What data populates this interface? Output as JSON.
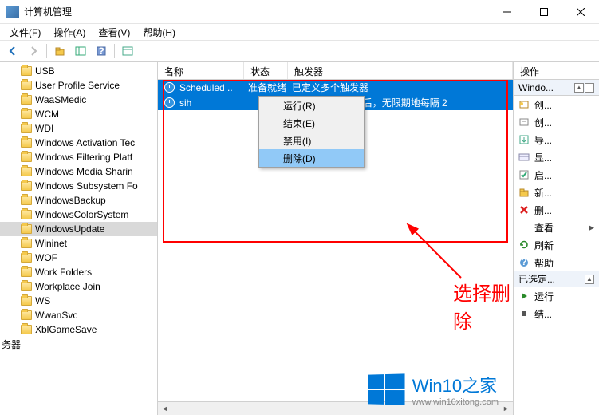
{
  "window": {
    "title": "计算机管理"
  },
  "menu": {
    "file": "文件(F)",
    "action": "操作(A)",
    "view": "查看(V)",
    "help": "帮助(H)"
  },
  "tree": {
    "items": [
      {
        "label": "USB"
      },
      {
        "label": "User Profile Service"
      },
      {
        "label": "WaaSMedic"
      },
      {
        "label": "WCM"
      },
      {
        "label": "WDI"
      },
      {
        "label": "Windows Activation Tec"
      },
      {
        "label": "Windows Filtering Platf"
      },
      {
        "label": "Windows Media Sharin"
      },
      {
        "label": "Windows Subsystem Fo"
      },
      {
        "label": "WindowsBackup"
      },
      {
        "label": "WindowsColorSystem"
      },
      {
        "label": "WindowsUpdate",
        "selected": true
      },
      {
        "label": "Wininet"
      },
      {
        "label": "WOF"
      },
      {
        "label": "Work Folders"
      },
      {
        "label": "Workplace Join"
      },
      {
        "label": "WS"
      },
      {
        "label": "WwanSvc"
      },
      {
        "label": "XblGameSave"
      }
    ],
    "footer": "务器"
  },
  "list": {
    "headers": {
      "name": "名称",
      "status": "状态",
      "trigger": "触发器"
    },
    "rows": [
      {
        "name": "Scheduled ..",
        "status": "准备就绪",
        "trigger": "已定义多个触发器"
      },
      {
        "name": "sih",
        "status": "",
        "trigger": "的 8:00 时 - 触发后，无限期地每隔 2"
      }
    ]
  },
  "context_menu": {
    "items": [
      {
        "label": "运行(R)"
      },
      {
        "label": "结束(E)"
      },
      {
        "label": "禁用(I)"
      },
      {
        "label": "删除(D)",
        "hover": true
      }
    ]
  },
  "annotation": "选择删除",
  "actions": {
    "header": "操作",
    "group1": {
      "title": "Windo..."
    },
    "items1": [
      {
        "icon": "create-basic",
        "label": "创..."
      },
      {
        "icon": "create",
        "label": "创..."
      },
      {
        "icon": "import",
        "label": "导..."
      },
      {
        "icon": "display",
        "label": "显..."
      },
      {
        "icon": "enable",
        "label": "启..."
      },
      {
        "icon": "new-folder",
        "label": "新..."
      },
      {
        "icon": "delete",
        "label": "删..."
      },
      {
        "icon": "view",
        "label": "查看",
        "submenu": true
      },
      {
        "icon": "refresh",
        "label": "刷新"
      },
      {
        "icon": "help",
        "label": "帮助"
      }
    ],
    "group2": {
      "title": "已选定..."
    },
    "items2": [
      {
        "icon": "run",
        "label": "运行"
      },
      {
        "icon": "end",
        "label": "结..."
      }
    ]
  },
  "watermark": {
    "title": "Win10之家",
    "url": "www.win10xitong.com"
  }
}
